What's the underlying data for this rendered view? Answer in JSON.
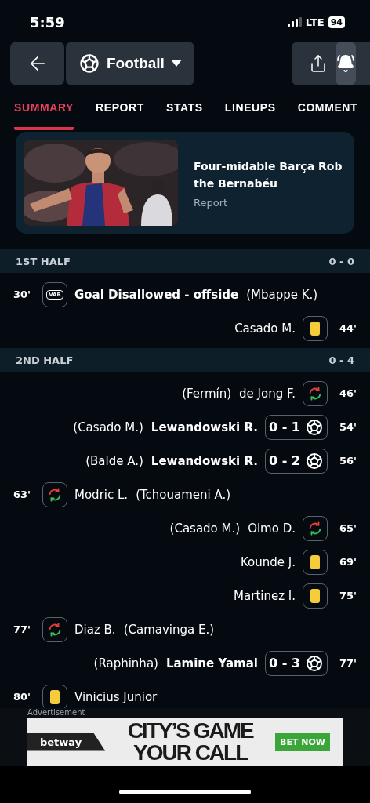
{
  "status_bar": {
    "time": "5:59",
    "network": "LTE",
    "battery": "94"
  },
  "header": {
    "sport": "Football"
  },
  "tabs": [
    {
      "label": "SUMMARY",
      "selected": true
    },
    {
      "label": "REPORT",
      "selected": false
    },
    {
      "label": "STATS",
      "selected": false
    },
    {
      "label": "LINEUPS",
      "selected": false
    },
    {
      "label": "COMMENT",
      "selected": false
    }
  ],
  "article": {
    "kind": "picture",
    "title": "Four-midable Barça Rob the Bernabéu",
    "subtitle": "Report"
  },
  "periods": [
    {
      "label": "1ST HALF",
      "score": "0 - 0",
      "events": [
        {
          "away": false,
          "minute": "30'",
          "kind": "var",
          "badge": "VAR",
          "player": "Goal Disallowed - offside",
          "detail": "(Mbappe K.)"
        },
        {
          "away": true,
          "minute": "44'",
          "kind": "yellow",
          "player": "Casado M."
        }
      ]
    },
    {
      "label": "2ND HALF",
      "score": "0 - 4",
      "events": [
        {
          "away": true,
          "minute": "46'",
          "kind": "sub",
          "player": "de Jong F.",
          "detail": "(Fermín)"
        },
        {
          "away": true,
          "minute": "54'",
          "kind": "goal",
          "score": "0 - 1",
          "player": "Lewandowski R.",
          "detail": "(Casado M.)"
        },
        {
          "away": true,
          "minute": "56'",
          "kind": "goal",
          "score": "0 - 2",
          "player": "Lewandowski R.",
          "detail": "(Balde A.)"
        },
        {
          "away": false,
          "minute": "63'",
          "kind": "sub",
          "player": "Modric L.",
          "detail": "(Tchouameni A.)"
        },
        {
          "away": true,
          "minute": "65'",
          "kind": "sub",
          "player": "Olmo D.",
          "detail": "(Casado M.)"
        },
        {
          "away": true,
          "minute": "69'",
          "kind": "yellow",
          "player": "Kounde J."
        },
        {
          "away": true,
          "minute": "75'",
          "kind": "yellow",
          "player": "Martinez I."
        },
        {
          "away": false,
          "minute": "77'",
          "kind": "sub",
          "player": "Diaz B.",
          "detail": "(Camavinga E.)"
        },
        {
          "away": true,
          "minute": "77'",
          "kind": "goal",
          "score": "0 - 3",
          "player": "Lamine Yamal",
          "detail": "(Raphinha)"
        },
        {
          "away": false,
          "minute": "80'",
          "kind": "yellow",
          "player": "Vinicius Junior"
        }
      ]
    }
  ],
  "advertisement": {
    "label": "Advertisement",
    "brand": "betway",
    "headline_1": "CITY’S GAME",
    "headline_2": "YOUR CALL",
    "cta": "BET NOW"
  }
}
